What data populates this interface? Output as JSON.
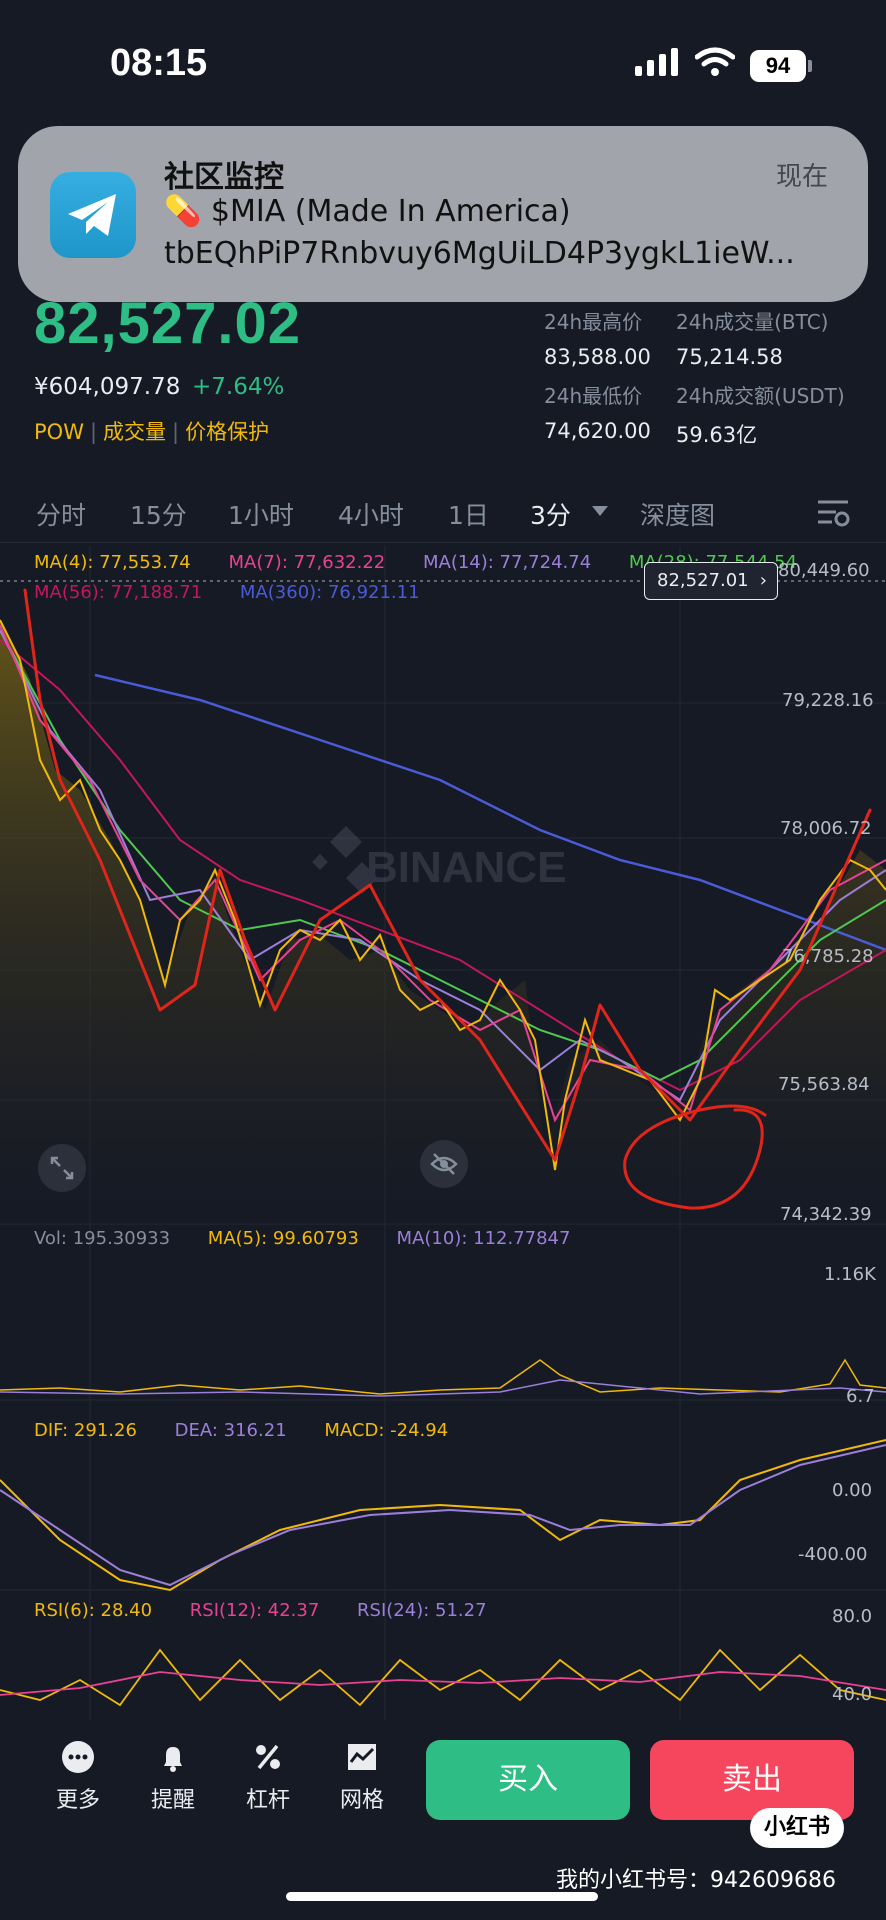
{
  "status_bar": {
    "time": "08:15",
    "battery": "94"
  },
  "notification": {
    "app": "telegram",
    "title": "社区监控",
    "time": "现在",
    "line1": "💊 $MIA (Made In America)",
    "line2": "tbEQhPiP7Rnbvuy6MgUiLD4P3ygkL1ieW..."
  },
  "ticker": {
    "last_price": "82,527.02",
    "cny_price": "¥604,097.78",
    "change_pct": "+7.64%",
    "tags": [
      "POW",
      "成交量",
      "价格保护"
    ],
    "stats": {
      "high_label": "24h最高价",
      "high": "83,588.00",
      "vol_btc_label": "24h成交量(BTC)",
      "vol_btc": "75,214.58",
      "low_label": "24h最低价",
      "low": "74,620.00",
      "vol_usdt_label": "24h成交额(USDT)",
      "vol_usdt": "59.63亿"
    }
  },
  "timeframes": [
    "分时",
    "15分",
    "1小时",
    "4小时",
    "1日",
    "3分",
    "深度图"
  ],
  "active_timeframe": "3分",
  "indicators": {
    "ma4": "MA(4): 77,553.74",
    "ma7": "MA(7): 77,632.22",
    "ma14": "MA(14): 77,724.74",
    "ma28": "MA(28): 77,544.54",
    "ma56": "MA(56): 77,188.71",
    "ma360": "MA(360): 76,921.11",
    "vol": "Vol: 195.30933",
    "vol_ma5": "MA(5): 99.60793",
    "vol_ma10": "MA(10): 112.77847",
    "dif": "DIF: 291.26",
    "dea": "DEA: 316.21",
    "macd": "MACD: -24.94",
    "rsi6": "RSI(6): 28.40",
    "rsi12": "RSI(12): 42.37",
    "rsi24": "RSI(24): 51.27"
  },
  "price_axis": [
    "80,449.60",
    "79,228.16",
    "78,006.72",
    "76,785.28",
    "75,563.84",
    "74,342.39"
  ],
  "current_price_tag": "82,527.01",
  "vol_axis": [
    "1.16K",
    "6.7"
  ],
  "macd_axis": [
    "0.00",
    "-400.00"
  ],
  "rsi_axis": [
    "80.0",
    "40.0"
  ],
  "watermark_logo": "BINANCE",
  "colors": {
    "up": "#2ebd85",
    "down": "#f6465d",
    "ma4": "#f0b90b",
    "ma7": "#e84393",
    "ma14": "#9b7fd8",
    "ma28": "#4fc84f",
    "ma56": "#c2185b",
    "ma360": "#4a5bd8"
  },
  "bottom_bar": {
    "more": "更多",
    "alert": "提醒",
    "leverage": "杠杆",
    "grid": "网格",
    "buy": "买入",
    "sell": "卖出"
  },
  "overlay": {
    "badge": "小红书",
    "watermark": "我的小红书号：942609686"
  }
}
